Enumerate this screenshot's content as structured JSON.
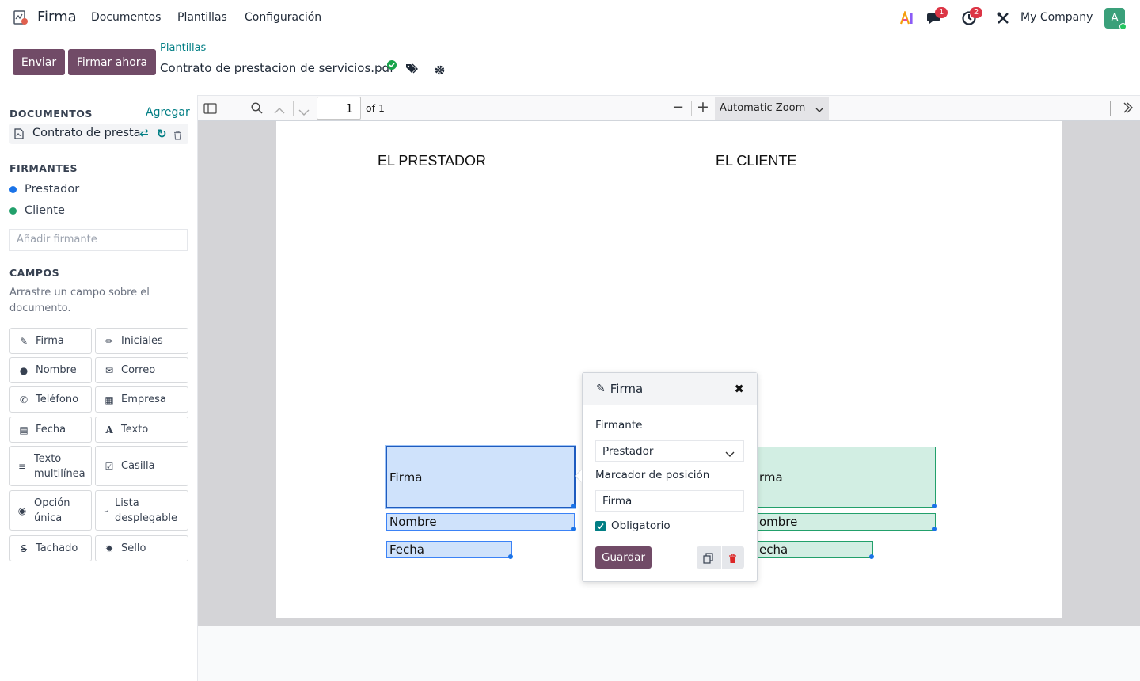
{
  "topbar": {
    "app_name": "Firma",
    "menu": [
      "Documentos",
      "Plantillas",
      "Configuración"
    ],
    "messages_count": "1",
    "activities_count": "2",
    "company": "My Company",
    "avatar_letter": "A"
  },
  "actions": {
    "send": "Enviar",
    "sign_now": "Firmar ahora",
    "breadcrumb": "Plantillas",
    "title": "Contrato de prestacion de servicios.pdf"
  },
  "sidebar": {
    "documents_title": "DOCUMENTOS",
    "add_label": "Agregar",
    "document_name": "Contrato de presta",
    "signers_title": "FIRMANTES",
    "signers": [
      {
        "name": "Prestador",
        "color": "#1a73e8"
      },
      {
        "name": "Cliente",
        "color": "#22a06b"
      }
    ],
    "add_signer_placeholder": "Añadir firmante",
    "fields_title": "CAMPOS",
    "fields_hint": "Arrastre un campo sobre el documento.",
    "fields": [
      {
        "label": "Firma",
        "icon": "edit-icon"
      },
      {
        "label": "Iniciales",
        "icon": "pencil-icon"
      },
      {
        "label": "Nombre",
        "icon": "user-icon"
      },
      {
        "label": "Correo",
        "icon": "envelope-icon"
      },
      {
        "label": "Teléfono",
        "icon": "phone-icon"
      },
      {
        "label": "Empresa",
        "icon": "building-icon"
      },
      {
        "label": "Fecha",
        "icon": "calendar-icon"
      },
      {
        "label": "Texto",
        "icon": "font-icon"
      },
      {
        "label": "Texto multilínea",
        "icon": "lines-icon"
      },
      {
        "label": "Casilla",
        "icon": "checkbox-icon"
      },
      {
        "label": "Opción única",
        "icon": "radio-icon"
      },
      {
        "label": "Lista desplegable",
        "icon": "chevron-down-icon"
      },
      {
        "label": "Tachado",
        "icon": "strikethrough-icon"
      },
      {
        "label": "Sello",
        "icon": "seal-icon"
      }
    ]
  },
  "pdf_toolbar": {
    "page": "1",
    "of_pages": "of 1",
    "zoom": "Automatic Zoom"
  },
  "pdf": {
    "left_heading": "EL PRESTADOR",
    "right_heading": "EL CLIENTE",
    "left_fields": [
      "Firma",
      "Nombre",
      "Fecha"
    ],
    "right_fields": [
      "rma",
      "ombre",
      "echa"
    ]
  },
  "popover": {
    "title": "Firma",
    "signer_label": "Firmante",
    "signer_value": "Prestador",
    "placeholder_label": "Marcador de posición",
    "placeholder_value": "Firma",
    "required_label": "Obligatorio",
    "required": true,
    "save": "Guardar"
  },
  "colors": {
    "primary": "#714b67",
    "link": "#017e84",
    "prestador": "#1a73e8",
    "cliente": "#22a06b"
  }
}
